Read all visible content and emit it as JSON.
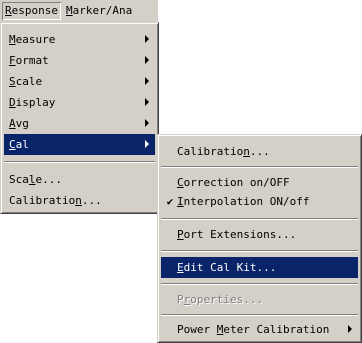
{
  "menubar": {
    "items": [
      {
        "label": "Response",
        "mnemonic": "R",
        "active": true
      },
      {
        "label": "Marker/Ana",
        "mnemonic": "M",
        "active": false
      }
    ]
  },
  "response_menu": {
    "items": [
      {
        "label": "Measure",
        "mnemonic": "M",
        "submenu": true
      },
      {
        "label": "Format",
        "mnemonic": "F",
        "submenu": true
      },
      {
        "label": "Scale",
        "mnemonic": "S",
        "submenu": true
      },
      {
        "label": "Display",
        "mnemonic": "D",
        "submenu": true
      },
      {
        "label": "Avg",
        "mnemonic": "A",
        "submenu": true
      },
      {
        "label": "Cal",
        "mnemonic": "C",
        "submenu": true,
        "selected": true
      },
      {
        "separator": true
      },
      {
        "label": "Scale...",
        "mnemonic": "l"
      },
      {
        "label": "Calibration...",
        "mnemonic": "n"
      }
    ]
  },
  "cal_submenu": {
    "items": [
      {
        "label": "Calibration...",
        "mnemonic": "n"
      },
      {
        "separator": true
      },
      {
        "label": "Correction on/OFF",
        "mnemonic": "C"
      },
      {
        "label": "Interpolation ON/off",
        "mnemonic": "I",
        "checked": true
      },
      {
        "separator": true
      },
      {
        "label": "Port Extensions...",
        "mnemonic": "P"
      },
      {
        "separator": true
      },
      {
        "label": "Edit Cal Kit...",
        "mnemonic": "E",
        "selected": true
      },
      {
        "separator": true
      },
      {
        "label": "Properties...",
        "mnemonic": "r",
        "disabled": true
      },
      {
        "separator": true
      },
      {
        "label": "Power Meter Calibration",
        "mnemonic": "M",
        "submenu": true
      }
    ]
  },
  "colors": {
    "menu_bg": "#d4d0c8",
    "highlight": "#0a246a",
    "disabled_text": "#808080"
  }
}
